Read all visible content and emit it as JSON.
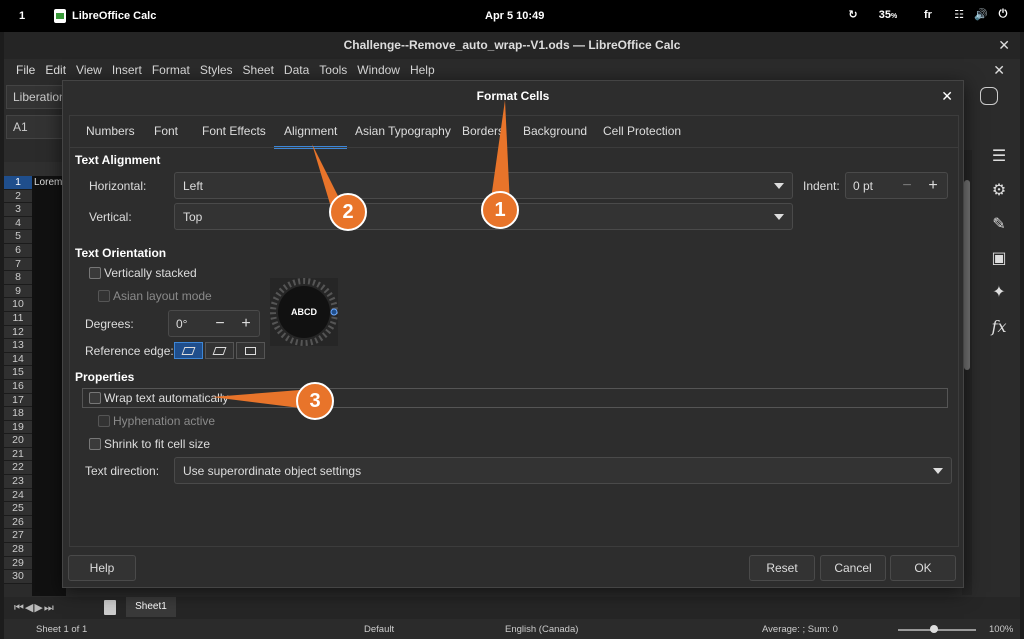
{
  "topbar": {
    "workspace": "1",
    "app_name": "LibreOffice Calc",
    "clock": "Apr 5  10:49",
    "battery": "35",
    "battery_unit": "%",
    "lang": "fr"
  },
  "window": {
    "title": "Challenge--Remove_auto_wrap--V1.ods — LibreOffice Calc"
  },
  "menubar": [
    "File",
    "Edit",
    "View",
    "Insert",
    "Format",
    "Styles",
    "Sheet",
    "Data",
    "Tools",
    "Window",
    "Help"
  ],
  "toolbar": {
    "font_name": "Liberation",
    "name_box": "A1"
  },
  "sheet": {
    "rows": [
      "1",
      "2",
      "3",
      "4",
      "5",
      "6",
      "7",
      "8",
      "9",
      "10",
      "11",
      "12",
      "13",
      "14",
      "15",
      "16",
      "17",
      "18",
      "19",
      "20",
      "21",
      "22",
      "23",
      "24",
      "25",
      "26",
      "27",
      "28",
      "29",
      "30"
    ],
    "cell_a1": "Lorem"
  },
  "dialog": {
    "title": "Format Cells",
    "tabs": [
      "Numbers",
      "Font",
      "Font Effects",
      "Alignment",
      "Asian Typography",
      "Borders",
      "Background",
      "Cell Protection"
    ],
    "active_tab": "Alignment",
    "text_alignment": {
      "heading": "Text Alignment",
      "horizontal_label": "Horizontal:",
      "horizontal_value": "Left",
      "indent_label": "Indent:",
      "indent_value": "0 pt",
      "vertical_label": "Vertical:",
      "vertical_value": "Top"
    },
    "text_orientation": {
      "heading": "Text Orientation",
      "vertically_stacked": "Vertically stacked",
      "asian_layout": "Asian layout mode",
      "degrees_label": "Degrees:",
      "degrees_value": "0°",
      "reference_edge_label": "Reference edge:",
      "dial_text": "ABCD"
    },
    "properties": {
      "heading": "Properties",
      "wrap_text": "Wrap text automatically",
      "hyphenation": "Hyphenation active",
      "shrink": "Shrink to fit cell size",
      "direction_label": "Text direction:",
      "direction_value": "Use superordinate object settings"
    },
    "buttons": {
      "help": "Help",
      "reset": "Reset",
      "cancel": "Cancel",
      "ok": "OK"
    }
  },
  "annotations": {
    "c1": "1",
    "c2": "2",
    "c3": "3",
    "color": "#e8742a"
  },
  "sheet_tabs": {
    "tab1": "Sheet1"
  },
  "statusbar": {
    "sheet_info": "Sheet 1 of 1",
    "style": "Default",
    "language": "English (Canada)",
    "summary": "Average: ; Sum: 0",
    "zoom": "100%"
  }
}
